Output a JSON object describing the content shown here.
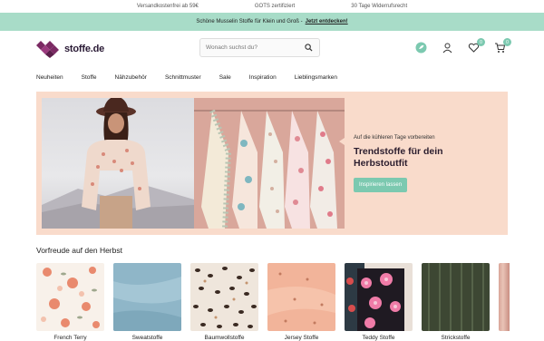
{
  "topbar": {
    "items": [
      "Versandkostenfrei ab 59€",
      "GOTS zertifiziert",
      "30 Tage Widerrufsrecht"
    ]
  },
  "promo": {
    "text": "Schöne Musselin Stoffe für Klein und Groß - ",
    "link": "Jetzt entdecken!"
  },
  "header": {
    "logo_text": "stoffe.de",
    "search_placeholder": "Wonach suchst du?",
    "wishlist_count": "0",
    "cart_count": "0"
  },
  "nav": {
    "items": [
      "Neuheiten",
      "Stoffe",
      "Nähzubehör",
      "Schnittmuster",
      "Sale",
      "Inspiration",
      "Lieblingsmarken"
    ]
  },
  "hero": {
    "subtitle": "Auf die kühleren Tage vorbereiten",
    "title_line1": "Trendstoffe für dein",
    "title_line2": "Herbstoutfit",
    "cta": "Inspirieren lassen"
  },
  "section": {
    "title": "Vorfreude auf den Herbst"
  },
  "categories": [
    {
      "label": "French Terry"
    },
    {
      "label": "Sweatstoffe"
    },
    {
      "label": "Baumwollstoffe"
    },
    {
      "label": "Jersey Stoffe"
    },
    {
      "label": "Teddy Stoffe"
    },
    {
      "label": "Strickstoffe"
    }
  ],
  "colors": {
    "accent": "#7cc9b0",
    "promo_bg": "#a8dcc8",
    "hero_bg": "#f9dbcb",
    "logo": "#7b2a63"
  }
}
